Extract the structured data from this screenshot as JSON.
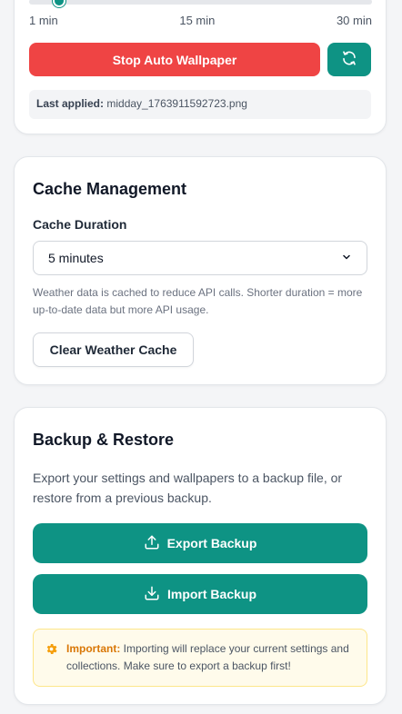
{
  "auto_wallpaper": {
    "interval": {
      "min_label": "1 min",
      "mid_label": "15 min",
      "max_label": "30 min",
      "value_fraction": 0.0
    },
    "stop_label": "Stop Auto Wallpaper",
    "refresh_icon": "refresh-icon",
    "last_applied_label": "Last applied:",
    "last_applied_value": "midday_1763911592723.png"
  },
  "cache": {
    "title": "Cache Management",
    "duration_label": "Cache Duration",
    "duration_value": "5 minutes",
    "help": "Weather data is cached to reduce API calls. Shorter duration = more up-to-date data but more API usage.",
    "clear_label": "Clear Weather Cache"
  },
  "backup": {
    "title": "Backup & Restore",
    "description": "Export your settings and wallpapers to a backup file, or restore from a previous backup.",
    "export_label": "Export Backup",
    "import_label": "Import Backup",
    "notice_strong": "Important:",
    "notice_text": " Importing will replace your current settings and collections. Make sure to export a backup first!"
  },
  "colors": {
    "accent": "#0e9384",
    "danger": "#ef4444",
    "warning": "#d97706"
  }
}
